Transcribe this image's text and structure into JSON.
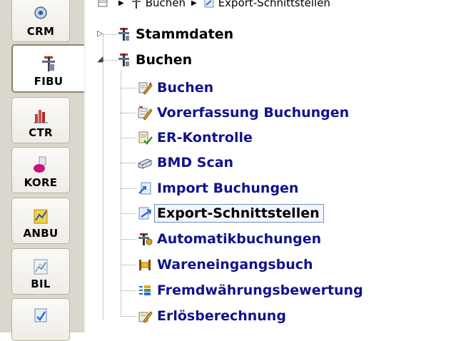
{
  "breadcrumb": {
    "items": [
      "Buchen",
      "Export-Schnittstellen"
    ]
  },
  "modules": [
    {
      "label": "CRM",
      "icon": "crm-icon"
    },
    {
      "label": "FIBU",
      "icon": "fibu-icon",
      "active": true
    },
    {
      "label": "CTR",
      "icon": "ctr-chart-icon"
    },
    {
      "label": "KORE",
      "icon": "kore-icon"
    },
    {
      "label": "ANBU",
      "icon": "anbu-icon"
    },
    {
      "label": "BIL",
      "icon": "bil-chart-icon"
    },
    {
      "label": "",
      "icon": "partial-module-icon"
    }
  ],
  "tree": {
    "stammdaten": {
      "label": "Stammdaten",
      "expander": "▷"
    },
    "buchen": {
      "label": "Buchen",
      "expander": "◢"
    },
    "children": [
      {
        "label": "Buchen",
        "icon": "posting-pencil-icon"
      },
      {
        "label": "Vorerfassung Buchungen",
        "icon": "pre-entry-icon"
      },
      {
        "label": "ER-Kontrolle",
        "icon": "invoice-check-icon"
      },
      {
        "label": "BMD Scan",
        "icon": "scanner-icon"
      },
      {
        "label": "Import Buchungen",
        "icon": "import-icon"
      },
      {
        "label": "Export-Schnittstellen",
        "icon": "export-icon",
        "selected": true
      },
      {
        "label": "Automatikbuchungen",
        "icon": "auto-posting-icon"
      },
      {
        "label": "Wareneingangsbuch",
        "icon": "goods-receipt-icon"
      },
      {
        "label": "Fremdwährungsbewertung",
        "icon": "currency-valuation-icon"
      },
      {
        "label": "Erlösberechnung",
        "icon": "revenue-calc-icon"
      }
    ]
  },
  "colors": {
    "modulebar_bg": "#dcd7cc",
    "child_text": "#12128c",
    "selection_border": "#6e8fc0"
  }
}
